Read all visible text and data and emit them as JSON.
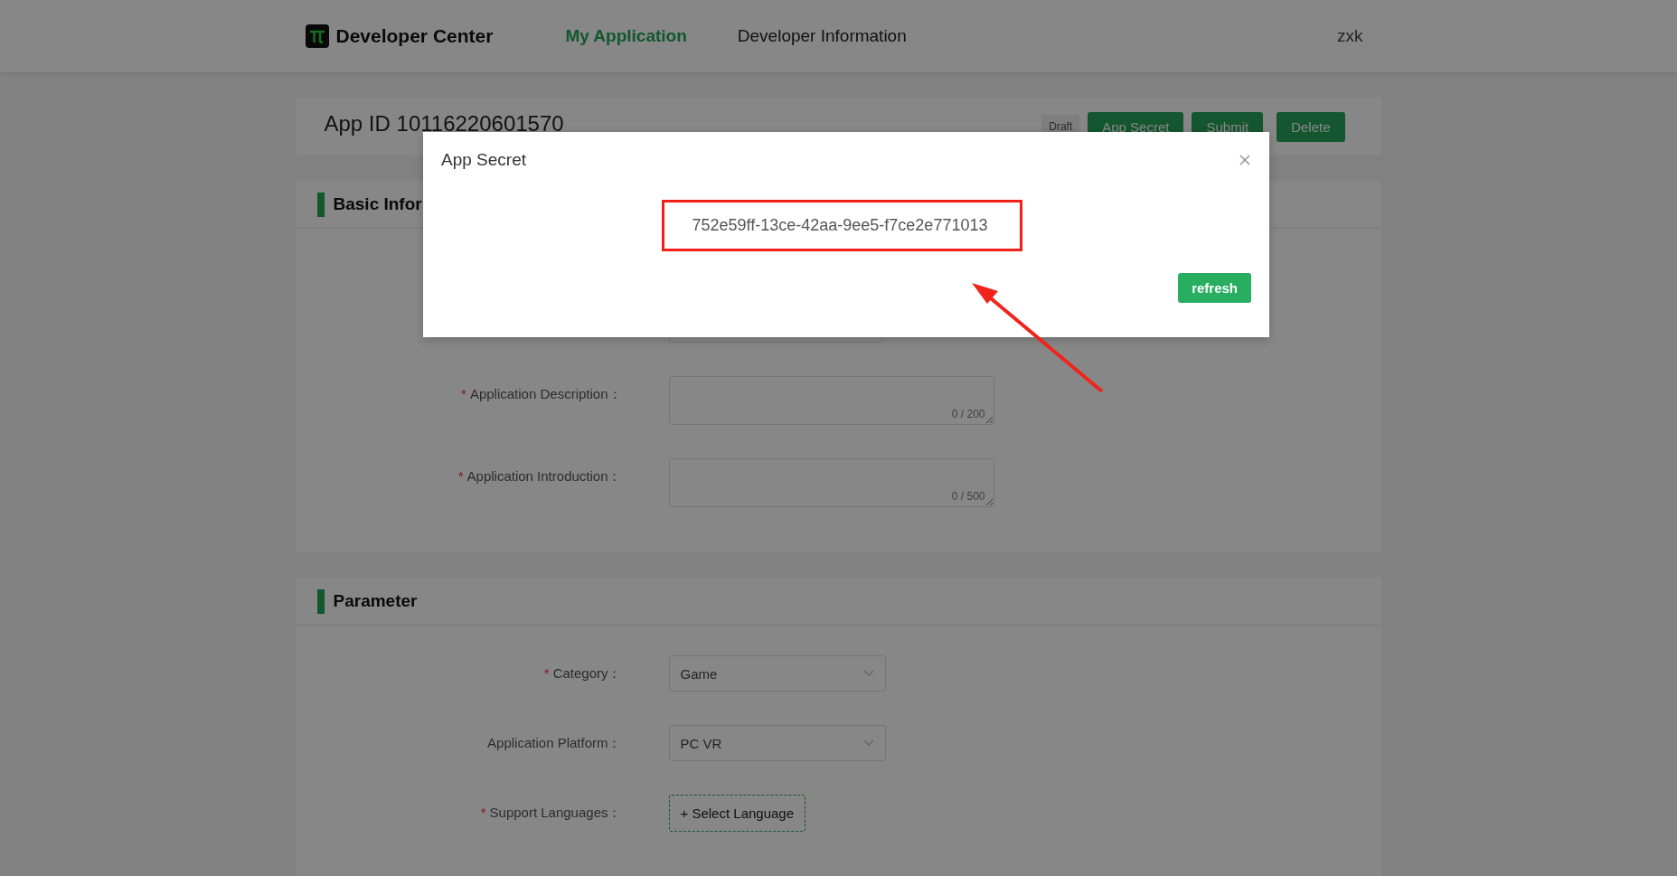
{
  "header": {
    "logo": "Developer Center",
    "nav": [
      {
        "label": "My Application",
        "selected": true
      },
      {
        "label": "Developer Information",
        "selected": false
      }
    ],
    "user": "zxk"
  },
  "app_bar": {
    "title": "App ID 10116220601570",
    "status": "Draft",
    "buttons": [
      "App Secret",
      "Submit",
      "Delete"
    ]
  },
  "sections": [
    {
      "title": "Basic Infor",
      "fields": [
        {
          "kind": "input"
        },
        {
          "label": "Application Description：",
          "required_mark": "*",
          "kind": "textarea",
          "counter": "0 / 200"
        },
        {
          "label": "Application Introduction：",
          "required_mark": "*",
          "kind": "textarea",
          "counter": "0 / 500"
        }
      ]
    },
    {
      "title": "Parameter",
      "fields": [
        {
          "label": "Category：",
          "required_mark": "*",
          "kind": "select",
          "value": "Game"
        },
        {
          "label": "Application Platform：",
          "kind": "select",
          "value": "PC VR"
        },
        {
          "label": "Support Languages：",
          "required_mark": "*",
          "kind": "button",
          "value": "+ Select Language"
        }
      ]
    }
  ],
  "dialog": {
    "title": "App Secret",
    "secret": "752e59ff-13ce-42aa-9ee5-f7ce2e771013",
    "button": "refresh"
  }
}
